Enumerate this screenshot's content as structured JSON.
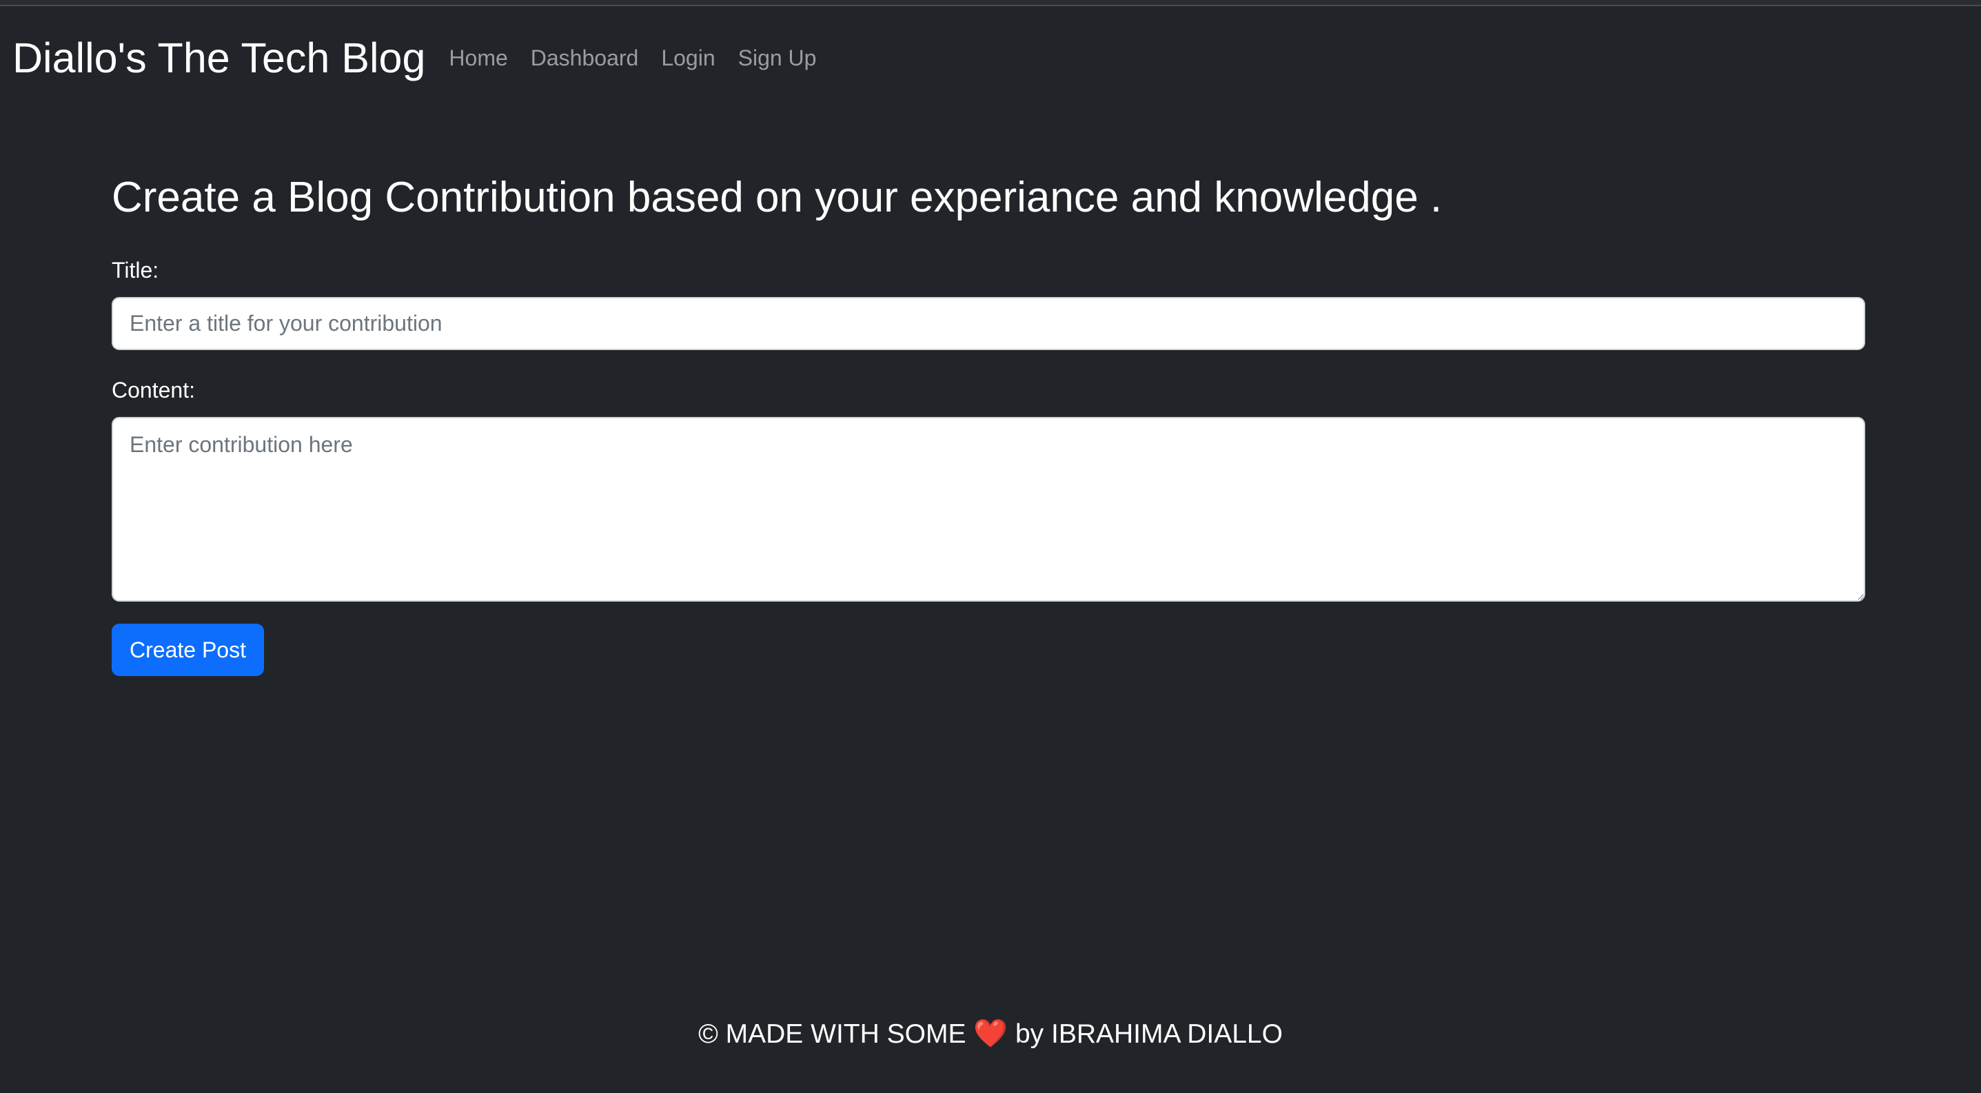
{
  "navbar": {
    "brand": "Diallo's The Tech Blog",
    "links": [
      "Home",
      "Dashboard",
      "Login",
      "Sign Up"
    ]
  },
  "main": {
    "heading": "Create a Blog Contribution based on your experiance and knowledge .",
    "title_label": "Title:",
    "title_placeholder": "Enter a title for your contribution",
    "content_label": "Content:",
    "content_placeholder": "Enter contribution here",
    "submit_label": "Create Post"
  },
  "footer": {
    "prefix": "© MADE WITH SOME",
    "heart": "❤️",
    "suffix": "by IBRAHIMA DIALLO"
  },
  "colors": {
    "background": "#212529",
    "primary_button": "#0d6efd",
    "nav_link": "#8c8e90",
    "heart": "#e0252b"
  }
}
